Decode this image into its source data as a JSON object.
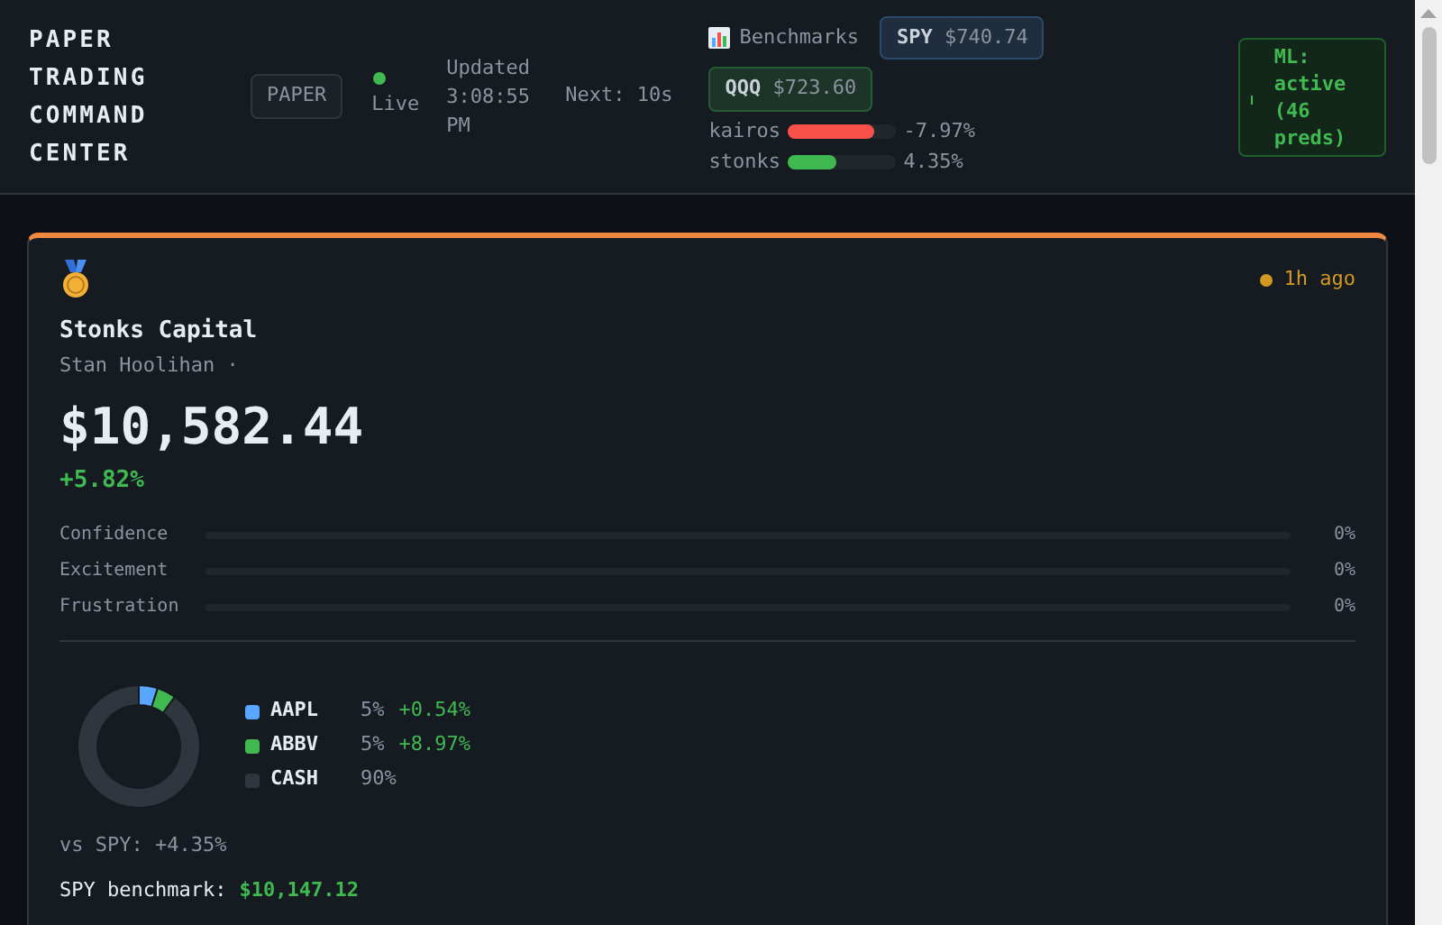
{
  "header": {
    "title": "PAPER TRADING COMMAND CENTER",
    "mode_badge": "PAPER",
    "live": {
      "label": "Live",
      "on": true
    },
    "updated": "Updated 3:08:55 PM",
    "next": "Next: 10s",
    "benchmarks": {
      "label": "Benchmarks",
      "quotes": [
        {
          "symbol": "SPY",
          "price": "$740.74",
          "color": "#2a4a6b"
        },
        {
          "symbol": "QQQ",
          "price": "$723.60",
          "color": "#265c33"
        }
      ],
      "bars": [
        {
          "name": "kairos",
          "level": 0.8,
          "color": "#f85149",
          "reading": "-7.97%"
        },
        {
          "name": "stonks",
          "level": 0.45,
          "color": "#3fb950",
          "reading": "4.35%"
        }
      ]
    },
    "ml_badge": "ML: active (46 preds)"
  },
  "card": {
    "status": {
      "text": "1h ago",
      "color": "#d29922"
    },
    "name": "Stonks Capital",
    "manager": "Stan Hoolihan ·",
    "value": "$10,582.44",
    "change": "+5.82%",
    "moods": [
      {
        "label": "Confidence",
        "level": 0,
        "reading": "0%"
      },
      {
        "label": "Excitement",
        "level": 0,
        "reading": "0%"
      },
      {
        "label": "Frustration",
        "level": 0,
        "reading": "0%"
      }
    ],
    "holdings": [
      {
        "weight": "5%",
        "return": "+0.54%",
        "color": "#58a6ff"
      },
      {
        "weight": "5%",
        "return": "+8.97%",
        "color": "#3fb950"
      },
      {
        "weight": "90%",
        "color": "#30363d"
      }
    ],
    "chart_data": {
      "type": "donut",
      "categories": [
        "AAPL",
        "ABBV",
        "CASH"
      ],
      "values": [
        5,
        5,
        90
      ]
    },
    "vs_spy": "vs SPY: +4.35%",
    "spy_benchmark": {
      "label": "SPY benchmark:",
      "value": "$10,147.12"
    }
  }
}
